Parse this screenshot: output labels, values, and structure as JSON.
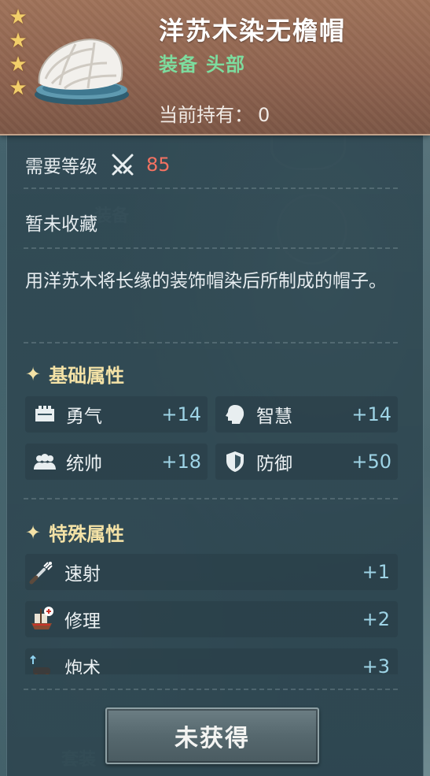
{
  "item": {
    "name": "洋苏木染无檐帽",
    "category": "装备",
    "slot": "头部",
    "stars": 4,
    "owned_label": "当前持有：",
    "owned_value": "0"
  },
  "requirement": {
    "label": "需要等级",
    "level": "85"
  },
  "collection_status": "暂未收藏",
  "description": "用洋苏木将长缘的装饰帽染后所制成的帽子。",
  "base_attributes": {
    "title": "基础属性",
    "items": [
      {
        "label": "勇气",
        "value": "+14",
        "icon": "courage-icon"
      },
      {
        "label": "智慧",
        "value": "+14",
        "icon": "wisdom-icon"
      },
      {
        "label": "统帅",
        "value": "+18",
        "icon": "command-icon"
      },
      {
        "label": "防御",
        "value": "+50",
        "icon": "shield-icon"
      }
    ]
  },
  "special_attributes": {
    "title": "特殊属性",
    "items": [
      {
        "label": "速射",
        "value": "+1",
        "icon": "rapid-fire-icon"
      },
      {
        "label": "修理",
        "value": "+2",
        "icon": "repair-ship-icon"
      },
      {
        "label": "炮术",
        "value": "+3",
        "icon": "cannon-icon"
      }
    ]
  },
  "action_button": "未获得",
  "colors": {
    "header_bg": "#8f6450",
    "type_text": "#7ddc9e",
    "level_value": "#f37262",
    "section_title": "#f4e2a6",
    "attr_value": "#9ed4e6",
    "star": "#f2cf6a"
  }
}
